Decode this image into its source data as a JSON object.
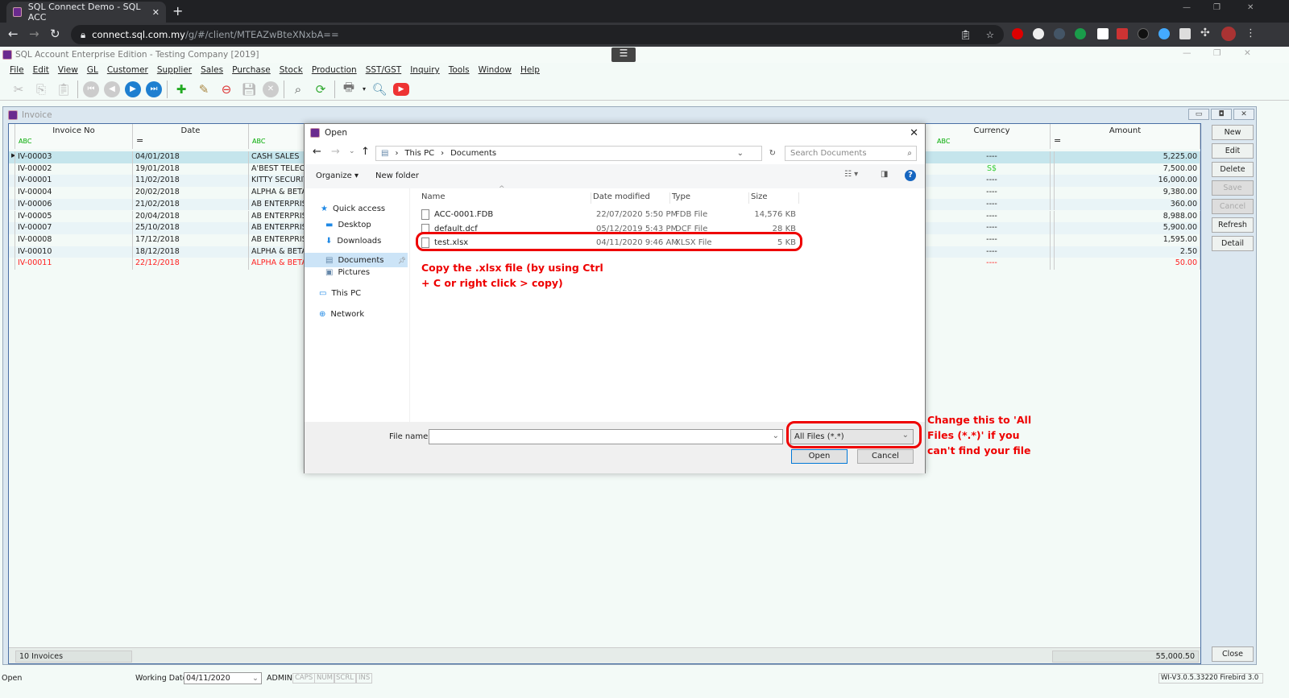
{
  "browser": {
    "tab_title": "SQL Connect Demo - SQL ACC",
    "url_host": "connect.sql.com.my",
    "url_path": "/g/#/client/MTEAZwBteXNxbA=="
  },
  "app": {
    "title": "SQL Account Enterprise Edition - Testing Company [2019]",
    "menu": [
      "File",
      "Edit",
      "View",
      "GL",
      "Customer",
      "Supplier",
      "Sales",
      "Purchase",
      "Stock",
      "Production",
      "SST/GST",
      "Inquiry",
      "Tools",
      "Window",
      "Help"
    ]
  },
  "invoice": {
    "title": "Invoice",
    "columns": [
      "Invoice No",
      "Date",
      "",
      "Currency",
      "Amount"
    ],
    "rows": [
      {
        "no": "IV-00003",
        "date": "04/01/2018",
        "customer": "CASH SALES",
        "currency": "----",
        "amount": "5,225.00"
      },
      {
        "no": "IV-00002",
        "date": "19/01/2018",
        "customer": "A'BEST TELECOM",
        "currency": "S$",
        "amount": "7,500.00"
      },
      {
        "no": "IV-00001",
        "date": "11/02/2018",
        "customer": "KITTY SECURITY",
        "currency": "----",
        "amount": "16,000.00"
      },
      {
        "no": "IV-00004",
        "date": "20/02/2018",
        "customer": "ALPHA & BETA C",
        "currency": "----",
        "amount": "9,380.00"
      },
      {
        "no": "IV-00006",
        "date": "21/02/2018",
        "customer": "AB ENTERPRISE S",
        "currency": "----",
        "amount": "360.00"
      },
      {
        "no": "IV-00005",
        "date": "20/04/2018",
        "customer": "AB ENTERPRISE S",
        "currency": "----",
        "amount": "8,988.00"
      },
      {
        "no": "IV-00007",
        "date": "25/10/2018",
        "customer": "AB ENTERPRISE S",
        "currency": "----",
        "amount": "5,900.00"
      },
      {
        "no": "IV-00008",
        "date": "17/12/2018",
        "customer": "AB ENTERPRISE S",
        "currency": "----",
        "amount": "1,595.00"
      },
      {
        "no": "IV-00010",
        "date": "18/12/2018",
        "customer": "ALPHA & BETA C",
        "currency": "----",
        "amount": "2.50"
      },
      {
        "no": "IV-00011",
        "date": "22/12/2018",
        "customer": "ALPHA & BETA C",
        "currency": "----",
        "amount": "50.00",
        "highlight": "red"
      }
    ],
    "count_label": "10 Invoices",
    "total": "55,000.50",
    "buttons": [
      "New",
      "Edit",
      "Delete",
      "Save",
      "Cancel",
      "Refresh",
      "Detail"
    ],
    "close_label": "Close"
  },
  "status": {
    "left": "Open",
    "working_date_label": "Working Date",
    "working_date": "04/11/2020",
    "user": "ADMIN",
    "keys": [
      "CAPS",
      "NUM",
      "SCRL",
      "INS"
    ],
    "version": "WI-V3.0.5.33220 Firebird 3.0"
  },
  "dialog": {
    "title": "Open",
    "crumbs": [
      "This PC",
      "Documents"
    ],
    "search_placeholder": "Search Documents",
    "organize": "Organize",
    "new_folder": "New folder",
    "nav": [
      "Quick access",
      "Desktop",
      "Downloads",
      "Documents",
      "Pictures",
      "This PC",
      "Network"
    ],
    "columns": [
      "Name",
      "Date modified",
      "Type",
      "Size"
    ],
    "files": [
      {
        "name": "ACC-0001.FDB",
        "modified": "22/07/2020 5:50 PM",
        "type": "FDB File",
        "size": "14,576 KB"
      },
      {
        "name": "default.dcf",
        "modified": "05/12/2019 5:43 PM",
        "type": "DCF File",
        "size": "28 KB"
      },
      {
        "name": "test.xlsx",
        "modified": "04/11/2020 9:46 AM",
        "type": "XLSX File",
        "size": "5 KB"
      }
    ],
    "file_name_label": "File name:",
    "file_name_value": "",
    "file_type": "All Files (*.*)",
    "open": "Open",
    "cancel": "Cancel"
  },
  "annotations": {
    "copy": "Copy the .xlsx file (by using Ctrl + C or right click > copy)",
    "change": "Change this to 'All Files (*.*)' if you can't find your file"
  },
  "colors": {
    "annotation": "#e00000",
    "selected_row": "#c5e5ec",
    "red_row": "#ff2020"
  }
}
